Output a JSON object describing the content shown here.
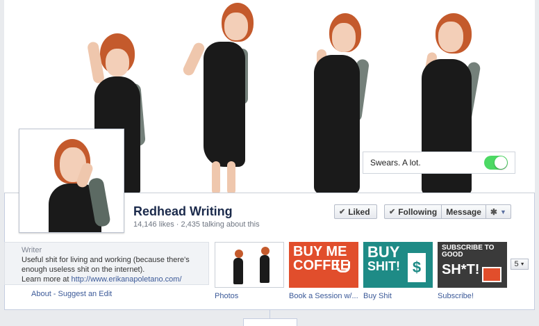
{
  "toggle": {
    "label": "Swears. A lot.",
    "state": "on"
  },
  "page": {
    "name": "Redhead Writing",
    "stats": "14,146 likes · 2,435 talking about this"
  },
  "actions": {
    "liked": "Liked",
    "following": "Following",
    "message": "Message",
    "settings_icon": "gear-icon",
    "dropdown_icon": "caret-down-icon"
  },
  "about": {
    "header": "Writer",
    "description": "Useful shit for living and working (because there's enough useless shit on the internet).",
    "learn_more_prefix": "Learn more at",
    "url": "http://www.erikanapoletano.com/",
    "links": "About - Suggest an Edit"
  },
  "apps": [
    {
      "label": "Photos"
    },
    {
      "label": "Book a Session w/...",
      "tile_line1": "BUY ME",
      "tile_line2": "COFFEE",
      "icon": "coffee-cup-icon"
    },
    {
      "label": "Buy Shit",
      "tile_line1": "BUY",
      "tile_line2": "SHIT!",
      "icon": "dollar-icon"
    },
    {
      "label": "Subscribe!",
      "tile_line1": "SUBSCRIBE TO GOOD",
      "tile_line2": "SH*T!",
      "icon": "envelope-icon"
    }
  ],
  "apps_more": "5",
  "colors": {
    "toggle_on": "#4cd964",
    "link": "#3b5998",
    "coffee_tile": "#e14e2c",
    "buy_tile": "#1e8b86",
    "subscribe_tile": "#3a3a3a"
  }
}
